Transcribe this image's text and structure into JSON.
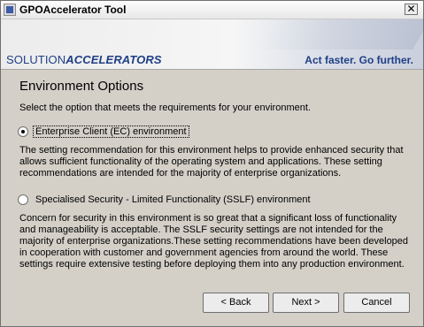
{
  "window": {
    "title": "GPOAccelerator Tool",
    "close_glyph": "✕"
  },
  "banner": {
    "brand_prefix": "SOLUTION",
    "brand_emphasis": "ACCELERATORS",
    "tagline": "Act faster. Go further."
  },
  "page": {
    "heading": "Environment Options",
    "instruction": "Select the option that meets the requirements for your environment."
  },
  "options": [
    {
      "label": "Enterprise Client (EC) environment",
      "selected": true,
      "description": "The setting recommendation for this environment helps to provide enhanced security that allows sufficient functionality of the operating system and applications. These setting recommendations are intended for the majority of enterprise organizations."
    },
    {
      "label": "Specialised Security - Limited Functionality (SSLF) environment",
      "selected": false,
      "description": "Concern for security in this environment is so great that a significant loss of functionality and manageability is acceptable. The SSLF security settings are not intended for the majority of enterprise organizations.These setting recommendations have been developed in cooperation with customer and government agencies from around the world. These settings require extensive testing before deploying them into any production environment."
    }
  ],
  "buttons": {
    "back": "< Back",
    "next": "Next >",
    "cancel": "Cancel"
  }
}
